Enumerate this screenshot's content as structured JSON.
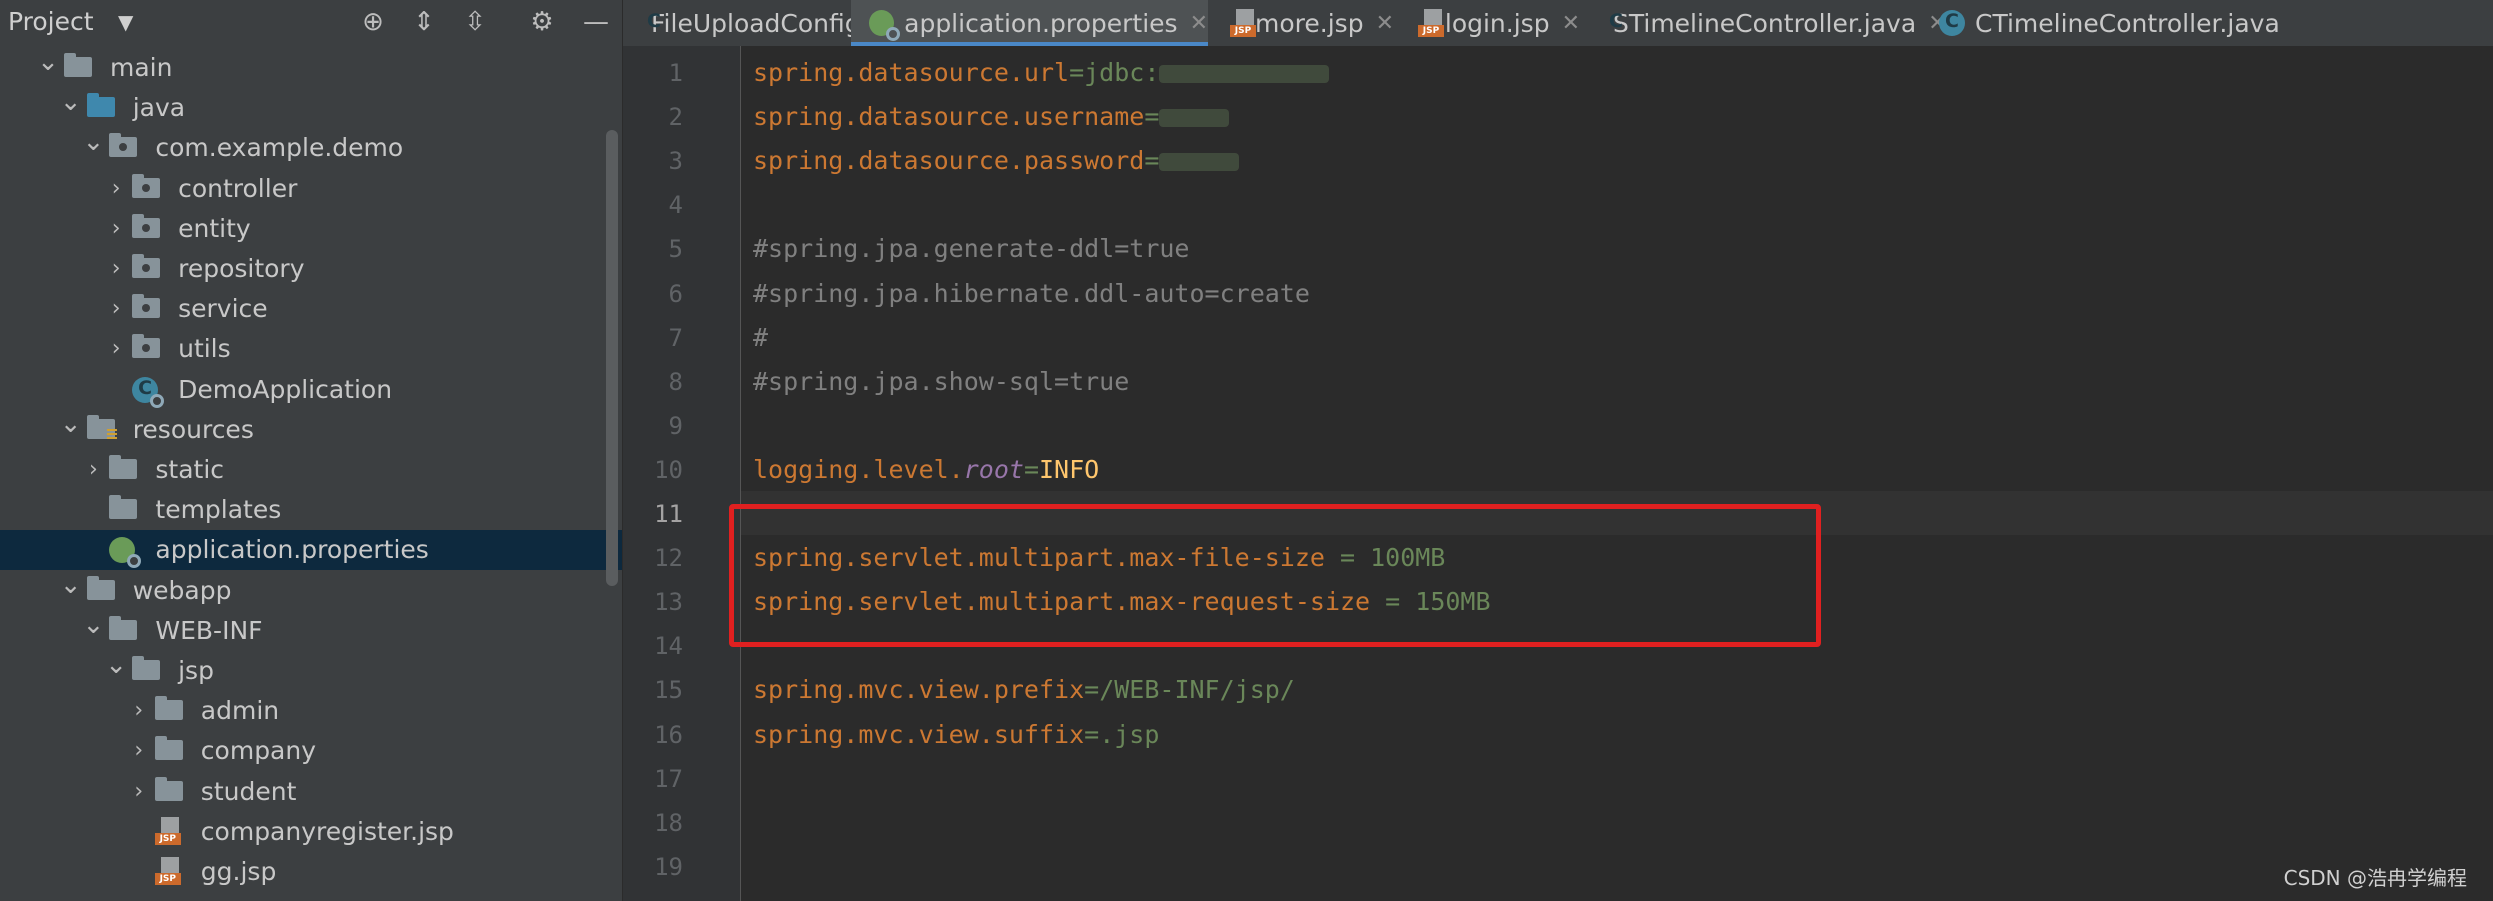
{
  "sidebar": {
    "title": "Project",
    "tree": [
      {
        "label": "main",
        "depth": 1,
        "expand": "open",
        "icon": "folder"
      },
      {
        "label": "java",
        "depth": 2,
        "expand": "open",
        "icon": "folder-blue"
      },
      {
        "label": "com.example.demo",
        "depth": 3,
        "expand": "open",
        "icon": "package"
      },
      {
        "label": "controller",
        "depth": 4,
        "expand": "closed",
        "icon": "package"
      },
      {
        "label": "entity",
        "depth": 4,
        "expand": "closed",
        "icon": "package"
      },
      {
        "label": "repository",
        "depth": 4,
        "expand": "closed",
        "icon": "package"
      },
      {
        "label": "service",
        "depth": 4,
        "expand": "closed",
        "icon": "package"
      },
      {
        "label": "utils",
        "depth": 4,
        "expand": "closed",
        "icon": "package"
      },
      {
        "label": "DemoApplication",
        "depth": 4,
        "expand": "none",
        "icon": "spring-class"
      },
      {
        "label": "resources",
        "depth": 2,
        "expand": "open",
        "icon": "folder-resources"
      },
      {
        "label": "static",
        "depth": 3,
        "expand": "closed",
        "icon": "folder"
      },
      {
        "label": "templates",
        "depth": 3,
        "expand": "none",
        "icon": "folder"
      },
      {
        "label": "application.properties",
        "depth": 3,
        "expand": "none",
        "icon": "spring-properties",
        "selected": true
      },
      {
        "label": "webapp",
        "depth": 2,
        "expand": "open",
        "icon": "folder"
      },
      {
        "label": "WEB-INF",
        "depth": 3,
        "expand": "open",
        "icon": "folder"
      },
      {
        "label": "jsp",
        "depth": 4,
        "expand": "open",
        "icon": "folder"
      },
      {
        "label": "admin",
        "depth": 5,
        "expand": "closed",
        "icon": "folder"
      },
      {
        "label": "company",
        "depth": 5,
        "expand": "closed",
        "icon": "folder"
      },
      {
        "label": "student",
        "depth": 5,
        "expand": "closed",
        "icon": "folder"
      },
      {
        "label": "companyregister.jsp",
        "depth": 5,
        "expand": "none",
        "icon": "jsp"
      },
      {
        "label": "gg.jsp",
        "depth": 5,
        "expand": "none",
        "icon": "jsp"
      }
    ]
  },
  "tabs": [
    {
      "label": "FileUploadConfig.java",
      "icon": "class-icon",
      "active": false
    },
    {
      "label": "application.properties",
      "icon": "spring-properties-icon",
      "active": true
    },
    {
      "label": "more.jsp",
      "icon": "jsp-icon",
      "active": false
    },
    {
      "label": "login.jsp",
      "icon": "jsp-icon",
      "active": false
    },
    {
      "label": "STimelineController.java",
      "icon": "class-icon",
      "active": false
    },
    {
      "label": "CTimelineController.java",
      "icon": "class-icon",
      "active": false
    }
  ],
  "editor": {
    "current_line": 11,
    "lines": [
      {
        "n": "1",
        "tokens": [
          [
            "k",
            "spring.datasource.url"
          ],
          [
            "v",
            "=jdbc:"
          ],
          [
            "blur",
            "m"
          ]
        ]
      },
      {
        "n": "2",
        "tokens": [
          [
            "k",
            "spring.datasource.username"
          ],
          [
            "v",
            "="
          ],
          [
            "blur",
            "s"
          ]
        ]
      },
      {
        "n": "3",
        "tokens": [
          [
            "k",
            "spring.datasource.password"
          ],
          [
            "v",
            "="
          ],
          [
            "blur",
            "s"
          ]
        ]
      },
      {
        "n": "4",
        "tokens": []
      },
      {
        "n": "5",
        "tokens": [
          [
            "c",
            "#spring.jpa.generate-ddl=true"
          ]
        ]
      },
      {
        "n": "6",
        "tokens": [
          [
            "c",
            "#spring.jpa.hibernate.ddl-auto=create"
          ]
        ]
      },
      {
        "n": "7",
        "tokens": [
          [
            "c",
            "#"
          ]
        ]
      },
      {
        "n": "8",
        "tokens": [
          [
            "c",
            "#spring.jpa.show-sql=true"
          ]
        ]
      },
      {
        "n": "9",
        "tokens": []
      },
      {
        "n": "10",
        "tokens": [
          [
            "k",
            "logging.level."
          ],
          [
            "i",
            "root"
          ],
          [
            "v",
            "="
          ],
          [
            "y",
            "INFO"
          ]
        ]
      },
      {
        "n": "11",
        "tokens": []
      },
      {
        "n": "12",
        "tokens": [
          [
            "k",
            "spring.servlet.multipart.max-file-size"
          ],
          [
            "v",
            " = 100MB"
          ]
        ]
      },
      {
        "n": "13",
        "tokens": [
          [
            "k",
            "spring.servlet.multipart.max-request-size"
          ],
          [
            "v",
            " = 150MB"
          ]
        ]
      },
      {
        "n": "14",
        "tokens": []
      },
      {
        "n": "15",
        "tokens": [
          [
            "k",
            "spring.mvc.view.prefix"
          ],
          [
            "v",
            "=/WEB-INF/jsp/"
          ]
        ]
      },
      {
        "n": "16",
        "tokens": [
          [
            "k",
            "spring.mvc.view.suffix"
          ],
          [
            "v",
            "=.jsp"
          ]
        ]
      },
      {
        "n": "17",
        "tokens": []
      },
      {
        "n": "18",
        "tokens": []
      },
      {
        "n": "19",
        "tokens": []
      }
    ]
  },
  "watermark": "CSDN @浩冉学编程",
  "colors": {
    "keyword": "#cc7832",
    "value": "#6a8759",
    "comment": "#808080",
    "highlight_box": "#e02020"
  }
}
